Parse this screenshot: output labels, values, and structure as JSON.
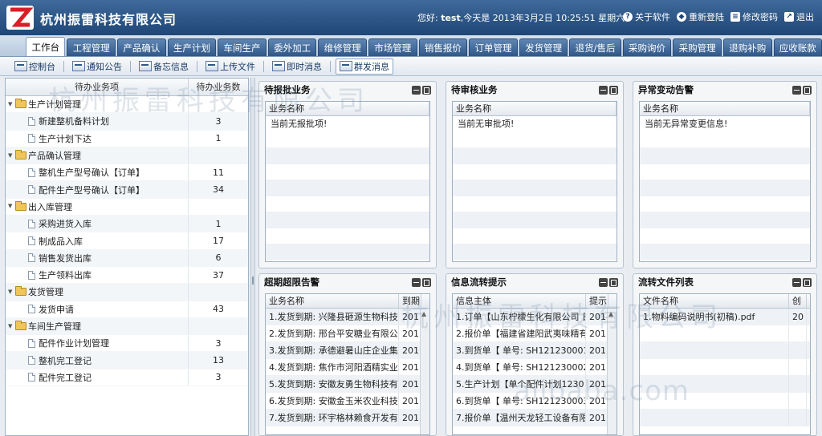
{
  "header": {
    "company": "杭州振雷科技有限公司",
    "greeting_prefix": "您好: ",
    "user": "test",
    "greeting_suffix": ",今天是 2013年3月2日 10:25:51 星期六",
    "links": [
      {
        "label": "关于软件",
        "icon": "info-icon"
      },
      {
        "label": "重新登陆",
        "icon": "relogin-icon"
      },
      {
        "label": "修改密码",
        "icon": "password-icon"
      },
      {
        "label": "退出",
        "icon": "exit-icon"
      }
    ]
  },
  "tabs": [
    "工作台",
    "工程管理",
    "产品确认",
    "生产计划",
    "车间生产",
    "委外加工",
    "维修管理",
    "市场管理",
    "销售报价",
    "订单管理",
    "发货管理",
    "退货/售后",
    "采购询价",
    "采购管理",
    "退购补购",
    "应收账款"
  ],
  "toolbar": [
    "控制台",
    "通知公告",
    "备忘信息",
    "上传文件",
    "即时消息",
    "群发消息"
  ],
  "tree": {
    "headers": [
      "待办业务项",
      "待办业务数"
    ],
    "rows": [
      {
        "type": "group",
        "label": "生产计划管理",
        "count": ""
      },
      {
        "type": "item",
        "label": "新建整机备料计划",
        "count": "3"
      },
      {
        "type": "item",
        "label": "生产计划下达",
        "count": "1"
      },
      {
        "type": "group",
        "label": "产品确认管理",
        "count": ""
      },
      {
        "type": "item",
        "label": "整机生产型号确认【订单】",
        "count": "11"
      },
      {
        "type": "item",
        "label": "配件生产型号确认【订单】",
        "count": "34"
      },
      {
        "type": "group",
        "label": "出入库管理",
        "count": ""
      },
      {
        "type": "item",
        "label": "采购进货入库",
        "count": "1"
      },
      {
        "type": "item",
        "label": "制成品入库",
        "count": "17"
      },
      {
        "type": "item",
        "label": "销售发货出库",
        "count": "6"
      },
      {
        "type": "item",
        "label": "生产领料出库",
        "count": "37"
      },
      {
        "type": "group",
        "label": "发货管理",
        "count": ""
      },
      {
        "type": "item",
        "label": "发货申请",
        "count": "43"
      },
      {
        "type": "group",
        "label": "车间生产管理",
        "count": ""
      },
      {
        "type": "item",
        "label": "配件作业计划管理",
        "count": "3"
      },
      {
        "type": "item",
        "label": "整机完工登记",
        "count": "13"
      },
      {
        "type": "item",
        "label": "配件完工登记",
        "count": "3"
      }
    ]
  },
  "panels": {
    "p1": {
      "title": "待报批业务",
      "col": "业务名称",
      "msg": "当前无报批项!"
    },
    "p2": {
      "title": "待审核业务",
      "col": "业务名称",
      "msg": "当前无审批项!"
    },
    "p3": {
      "title": "异常变动告警",
      "col": "业务名称",
      "msg": "当前无异常变更信息!"
    },
    "p4": {
      "title": "超期超限告警",
      "cols": [
        "业务名称",
        "到期"
      ],
      "rows": [
        [
          "1.发货到期: 兴隆县砸源生物科技开",
          "201"
        ],
        [
          "2.发货到期: 邢台平安糖业有限公司",
          "201"
        ],
        [
          "3.发货到期: 承德避暑山庄企业集团",
          "201"
        ],
        [
          "4.发货到期: 焦作市河阳酒精实业有",
          "201"
        ],
        [
          "5.发货到期: 安徽友勇生物科技有限",
          "201"
        ],
        [
          "6.发货到期: 安徽金玉米农业科技开",
          "201"
        ],
        [
          "7.发货到期: 环宇格林赖食开发有限",
          "201"
        ]
      ]
    },
    "p5": {
      "title": "信息流转提示",
      "cols": [
        "信息主体",
        "提示"
      ],
      "rows": [
        [
          "1.订单【山东柠檬生化有限公司 日期",
          "201"
        ],
        [
          "2.报价单【福建省建阳武夷味精有限",
          "201"
        ],
        [
          "3.到货单【 单号: SH121230001】",
          "201"
        ],
        [
          "4.到货单【 单号: SH121230002】",
          "201"
        ],
        [
          "5.生产计划【单个配件计划1230 日期",
          "201"
        ],
        [
          "6.到货单【 单号: SH121230003】",
          "201"
        ],
        [
          "7.报价单【温州天龙轻工设备有限公",
          "201"
        ]
      ]
    },
    "p6": {
      "title": "流转文件列表",
      "cols": [
        "文件名称",
        "创"
      ],
      "rows": [
        [
          "1.物料编码说明书(初稿).pdf",
          "20"
        ]
      ]
    }
  },
  "watermarks": [
    "杭州振雷科技有限公司",
    "alibaba.com"
  ]
}
